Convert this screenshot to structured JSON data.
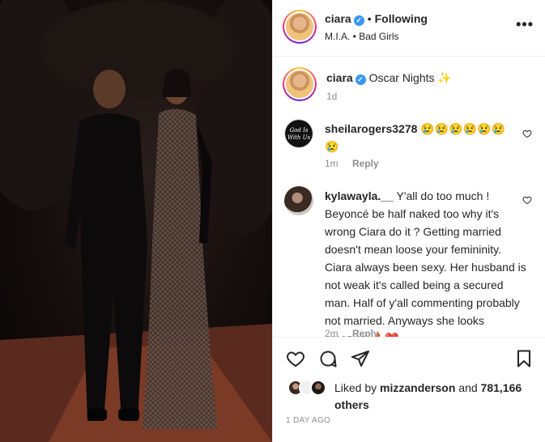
{
  "post": {
    "username": "ciara",
    "following_label": "Following",
    "audio": "M.I.A. • Bad Girls",
    "caption_username": "ciara",
    "caption": "Oscar Nights ✨",
    "caption_time": "1d",
    "timestamp": "1 DAY AGO"
  },
  "comments": [
    {
      "username": "sheilarogers3278",
      "text": "😢😢😢😢😢😢😢",
      "time": "1m",
      "reply_label": "Reply",
      "avatar_text": "God Is With Us"
    },
    {
      "username": "kylawayla.__",
      "text": "Y'all do too much ! Beyoncé be half naked too why it's wrong Ciara do it ? Getting married doesn't mean loose your femininity. Ciara always been sexy. Her husband is not weak it's called being a secured man. Half of y'all commenting probably not married. Anyways she looks amazing 🔥❤️",
      "time": "2m",
      "reply_label": "Reply"
    }
  ],
  "likes": {
    "prefix": "Liked by ",
    "liked_by": "mizzanderson",
    "middle": " and ",
    "others": "781,166 others"
  },
  "icons": {
    "more": "more-options-icon",
    "like": "heart-icon",
    "comment": "comment-icon",
    "share": "paper-plane-icon",
    "save": "bookmark-icon"
  },
  "colors": {
    "verified": "#3897f0",
    "secondary_text": "#8e8e8e",
    "divider": "#efefef"
  }
}
